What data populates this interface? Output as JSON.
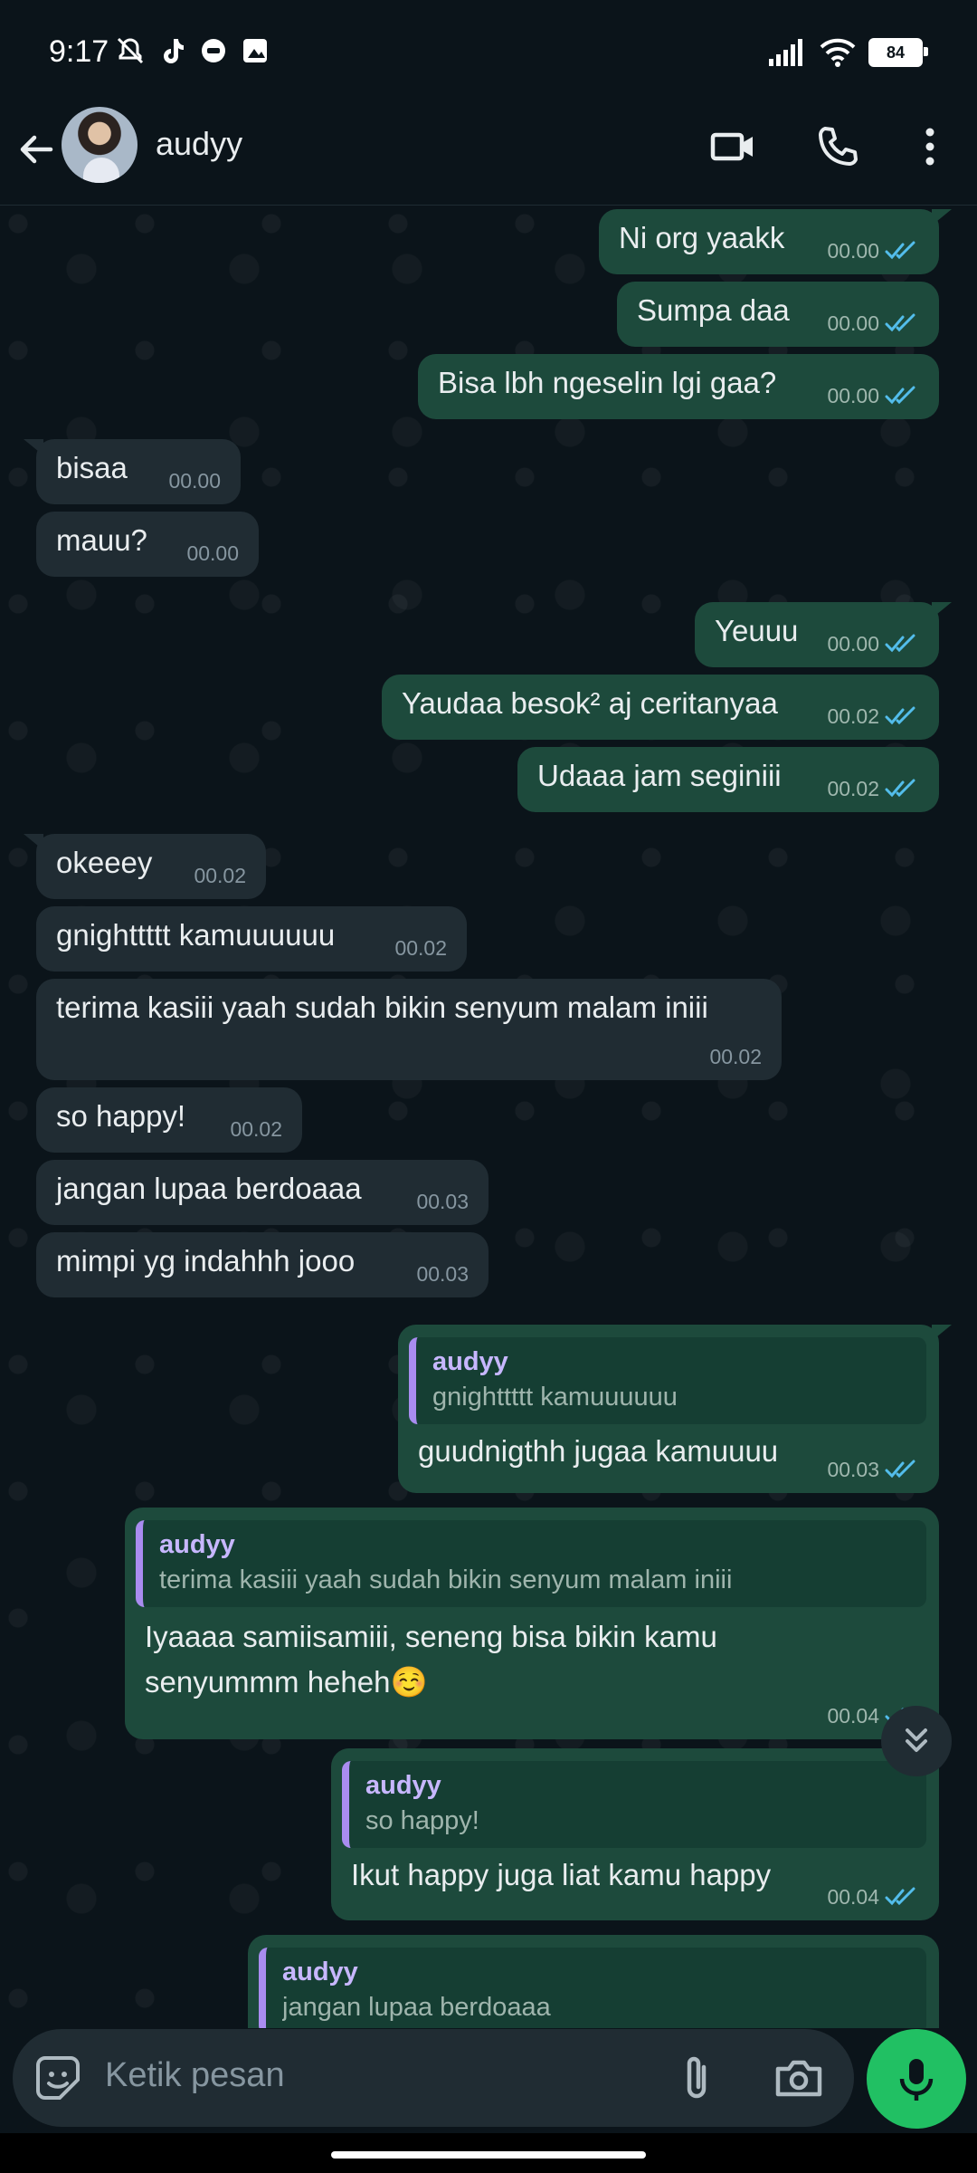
{
  "status_bar": {
    "time": "9:17",
    "battery": "84"
  },
  "header": {
    "contact_name": "audyy"
  },
  "messages": [
    {
      "text": "Ni org yaakk",
      "time": "00.00"
    },
    {
      "text": "Sumpa daa",
      "time": "00.00"
    },
    {
      "text": "Bisa lbh ngeselin lgi gaa?",
      "time": "00.00"
    },
    {
      "text": "bisaa",
      "time": "00.00"
    },
    {
      "text": "mauu?",
      "time": "00.00"
    },
    {
      "text": "Yeuuu",
      "time": "00.00"
    },
    {
      "text": "Yaudaa besok² aj ceritanyaa",
      "time": "00.02"
    },
    {
      "text": "Udaaa jam seginiii",
      "time": "00.02"
    },
    {
      "text": "okeeey",
      "time": "00.02"
    },
    {
      "text": "gnighttttt kamuuuuuu",
      "time": "00.02"
    },
    {
      "text": "terima kasiii yaah sudah bikin senyum malam iniii",
      "time": "00.02"
    },
    {
      "text": "so happy!",
      "time": "00.02"
    },
    {
      "text": "jangan lupaa berdoaaa",
      "time": "00.03"
    },
    {
      "text": "mimpi yg indahhh jooo",
      "time": "00.03"
    },
    {
      "reply_name": "audyy",
      "reply_text": "gnighttttt kamuuuuuu",
      "text": "guudnigthh jugaa kamuuuu",
      "time": "00.03"
    },
    {
      "reply_name": "audyy",
      "reply_text": "terima kasiii yaah sudah bikin senyum malam iniii",
      "text_line1": "Iyaaaa samiisamiii, seneng bisa bikin kamu",
      "text_line2": "senyummm heheh☺️",
      "time": "00.04"
    },
    {
      "reply_name": "audyy",
      "reply_text": "so happy!",
      "text": "Ikut happy juga liat kamu happy",
      "time": "00.04"
    },
    {
      "reply_name": "audyy",
      "reply_text": "jangan lupaa berdoaaa"
    }
  ],
  "input": {
    "placeholder": "Ketik pesan"
  },
  "colors": {
    "incoming": "#202c33",
    "outgoing": "#1d4a3c",
    "tick_read": "#53bdeb",
    "mic_button": "#21c063",
    "reply_bar": "#a98cf0"
  }
}
